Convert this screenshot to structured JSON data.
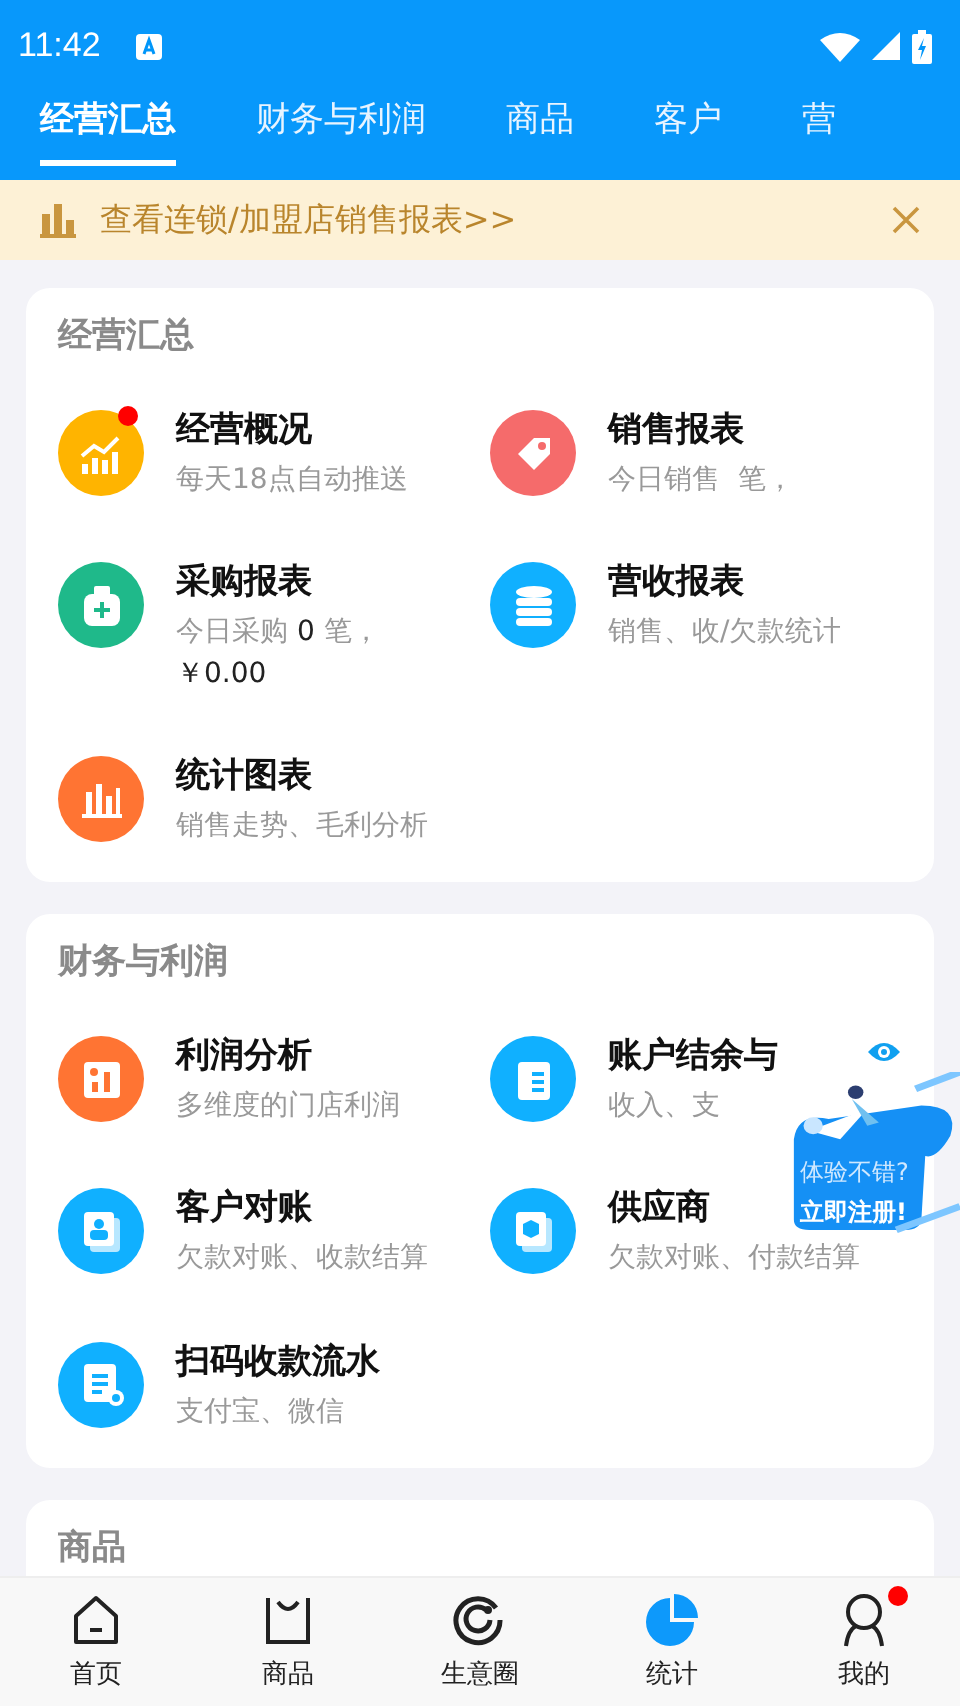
{
  "status_bar": {
    "time": "11:42"
  },
  "tabs": [
    {
      "label": "经营汇总",
      "selected": true
    },
    {
      "label": "财务与利润",
      "selected": false
    },
    {
      "label": "商品",
      "selected": false
    },
    {
      "label": "客户",
      "selected": false
    },
    {
      "label": "营",
      "selected": false
    }
  ],
  "banner": {
    "text": "查看连锁/加盟店销售报表>>"
  },
  "sections": [
    {
      "title": "经营汇总",
      "items": [
        {
          "title": "经营概况",
          "subtitle": "每天18点自动推送",
          "kind": "trend",
          "color": "#ffb400",
          "dot": true
        },
        {
          "title": "销售报表",
          "subtitle": "今日销售  笔，",
          "kind": "tag",
          "color": "#f56b6b"
        },
        {
          "title": "采购报表",
          "subtitle": "今日采购 **0** 笔，**￥0.00**",
          "kind": "bag",
          "color": "#1fb98a"
        },
        {
          "title": "营收报表",
          "subtitle": "销售、收/欠款统计",
          "kind": "coins",
          "color": "#10b0ff"
        },
        {
          "title": "统计图表",
          "subtitle": "销售走势、毛利分析",
          "kind": "bars",
          "color": "#ff7433"
        }
      ]
    },
    {
      "title": "财务与利润",
      "items": [
        {
          "title": "利润分析",
          "subtitle": "多维度的门店利润",
          "kind": "report",
          "color": "#ff7433"
        },
        {
          "title": "账户结余与",
          "subtitle": "收入、支",
          "kind": "notebook",
          "color": "#10b0ff",
          "eye": true
        },
        {
          "title": "客户对账",
          "subtitle": "欠款对账、收款结算",
          "kind": "contact",
          "color": "#10b0ff"
        },
        {
          "title": "供应商",
          "subtitle": "欠款对账、付款结算",
          "kind": "box",
          "color": "#10b0ff"
        },
        {
          "title": "扫码收款流水",
          "subtitle": "支付宝、微信",
          "kind": "receipt",
          "color": "#10b0ff"
        }
      ]
    },
    {
      "title": "商品"
    }
  ],
  "float_badge": {
    "lines": [
      "体验不错?",
      "立即注册!"
    ]
  },
  "bottom_nav": [
    {
      "label": "首页",
      "kind": "home",
      "selected": false
    },
    {
      "label": "商品",
      "kind": "bag",
      "selected": false
    },
    {
      "label": "生意圈",
      "kind": "circle",
      "selected": false
    },
    {
      "label": "统计",
      "kind": "pie",
      "selected": true
    },
    {
      "label": "我的",
      "kind": "person",
      "selected": false,
      "dot": true
    }
  ]
}
